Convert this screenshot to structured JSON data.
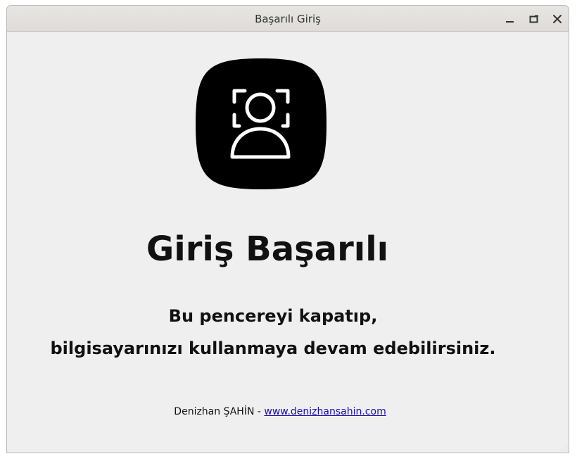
{
  "window": {
    "title": "Başarılı Giriş",
    "controls": {
      "minimize_icon": "minimize-icon",
      "maximize_icon": "maximize-icon",
      "close_icon": "close-icon"
    }
  },
  "main": {
    "icon": "face-id-user-icon",
    "headline": "Giriş Başarılı",
    "message_line1": "Bu pencereyi kapatıp,",
    "message_line2": "bilgisayarınızı kullanmaya devam edebilirsiniz.",
    "author": "Denizhan ŞAHİN",
    "separator": " - ",
    "website": "www.denizhansahin.com"
  },
  "colors": {
    "window_bg": "#efefef",
    "icon_bg": "#000000",
    "icon_fg": "#ffffff",
    "text": "#111111",
    "link": "#1a0dab"
  }
}
